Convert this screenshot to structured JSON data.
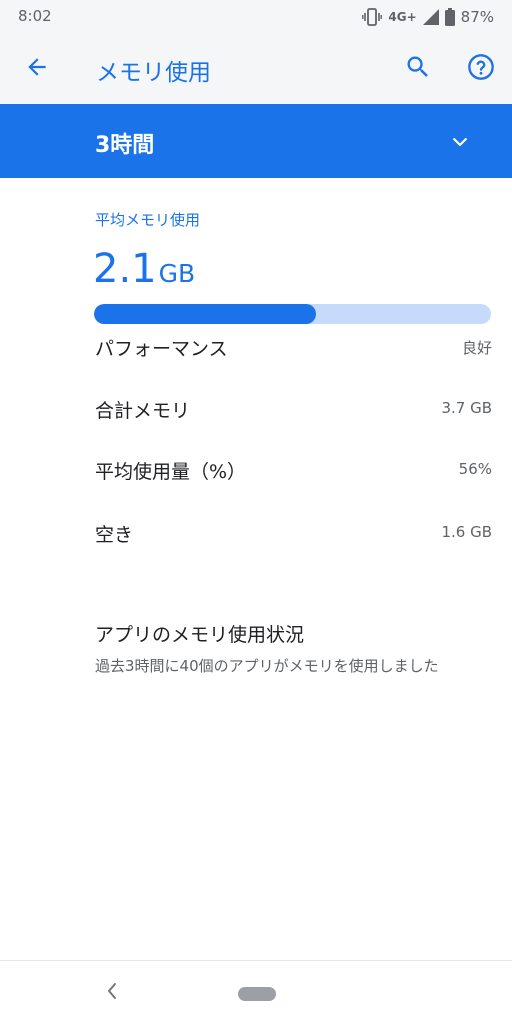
{
  "status_bar": {
    "time": "8:02",
    "network": "4G+",
    "battery": "87%"
  },
  "app_bar": {
    "title": "メモリ使用",
    "back_icon": "arrow-back-icon",
    "search_icon": "search-icon",
    "help_icon": "help-icon"
  },
  "range": {
    "selected": "3時間",
    "chevron_icon": "chevron-down-icon"
  },
  "memory": {
    "section_label": "平均メモリ使用",
    "value": "2.1",
    "unit": "GB",
    "usage_fraction": 0.56,
    "rows": [
      {
        "label": "パフォーマンス",
        "value": "良好"
      },
      {
        "label": "合計メモリ",
        "value": "3.7 GB"
      },
      {
        "label": "平均使用量（%）",
        "value": "56%"
      },
      {
        "label": "空き",
        "value": "1.6 GB"
      }
    ]
  },
  "app_usage": {
    "title": "アプリのメモリ使用状況",
    "summary": "過去3時間に40個のアプリがメモリを使用しました"
  },
  "colors": {
    "accent": "#1a73e8",
    "track": "#c6dafb",
    "text_primary": "#202124",
    "text_secondary": "#5f6368"
  }
}
